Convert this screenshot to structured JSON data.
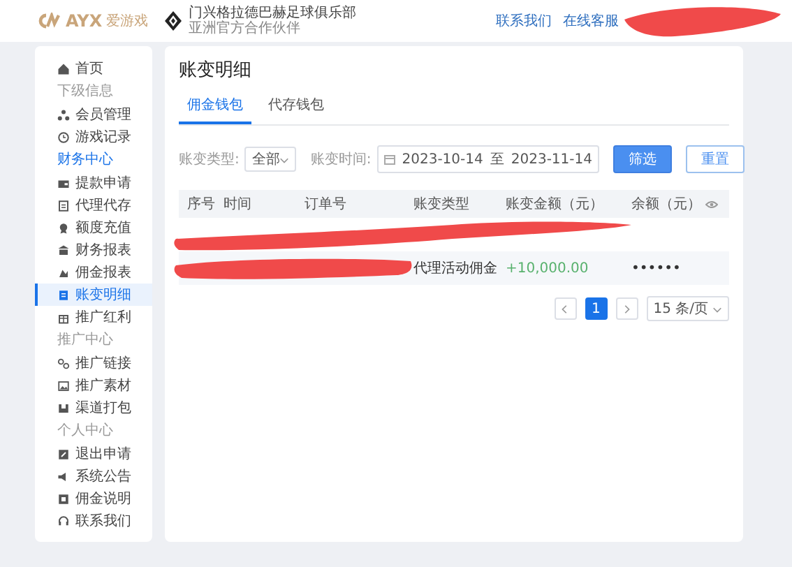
{
  "header": {
    "logo_mark": "AYX",
    "logo_text": "爱游戏",
    "partner_title": "门兴格拉德巴赫足球俱乐部",
    "partner_subtitle": "亚洲官方合作伙伴",
    "links": [
      "联系我们",
      "在线客服"
    ],
    "account_redacted": true
  },
  "sidebar": {
    "items": [
      {
        "kind": "item",
        "label": "首页",
        "selected": false
      },
      {
        "kind": "section",
        "label": "下级信息",
        "highlighted": false
      },
      {
        "kind": "item",
        "label": "会员管理",
        "selected": false
      },
      {
        "kind": "item",
        "label": "游戏记录",
        "selected": false
      },
      {
        "kind": "section",
        "label": "财务中心",
        "highlighted": true
      },
      {
        "kind": "item",
        "label": "提款申请",
        "selected": false
      },
      {
        "kind": "item",
        "label": "代理代存",
        "selected": false
      },
      {
        "kind": "item",
        "label": "额度充值",
        "selected": false
      },
      {
        "kind": "item",
        "label": "财务报表",
        "selected": false
      },
      {
        "kind": "item",
        "label": "佣金报表",
        "selected": false
      },
      {
        "kind": "item",
        "label": "账变明细",
        "selected": true
      },
      {
        "kind": "item",
        "label": "推广红利",
        "selected": false
      },
      {
        "kind": "section",
        "label": "推广中心",
        "highlighted": false
      },
      {
        "kind": "item",
        "label": "推广链接",
        "selected": false
      },
      {
        "kind": "item",
        "label": "推广素材",
        "selected": false
      },
      {
        "kind": "item",
        "label": "渠道打包",
        "selected": false
      },
      {
        "kind": "section",
        "label": "个人中心",
        "highlighted": false
      },
      {
        "kind": "item",
        "label": "退出申请",
        "selected": false
      },
      {
        "kind": "item",
        "label": "系统公告",
        "selected": false
      },
      {
        "kind": "item",
        "label": "佣金说明",
        "selected": false
      },
      {
        "kind": "item",
        "label": "联系我们",
        "selected": false
      }
    ]
  },
  "page": {
    "title": "账变明细",
    "tabs": [
      {
        "label": "佣金钱包",
        "selected": true
      },
      {
        "label": "代存钱包",
        "selected": false
      }
    ],
    "filters": {
      "type_label": "账变类型:",
      "type_value": "全部",
      "time_label": "账变时间:",
      "date_from": "2023-10-14",
      "date_sep": "至",
      "date_to": "2023-11-14"
    },
    "buttons": [
      {
        "label": "筛选",
        "kind": "primary"
      },
      {
        "label": "重置",
        "kind": "plain"
      }
    ],
    "table": {
      "columns": [
        "序号",
        "时间",
        "订单号",
        "账变类型",
        "账变金额（元）",
        "余额（元）"
      ],
      "rows": [
        {
          "kind": "redacted"
        },
        {
          "kind": "partly_redacted",
          "type": "代理活动佣金",
          "amount": "+10,000.00",
          "balance": "••••••"
        }
      ]
    },
    "pagination": {
      "pages": [
        {
          "label": "1",
          "selected": true
        }
      ],
      "page_size": "15 条/页"
    }
  }
}
